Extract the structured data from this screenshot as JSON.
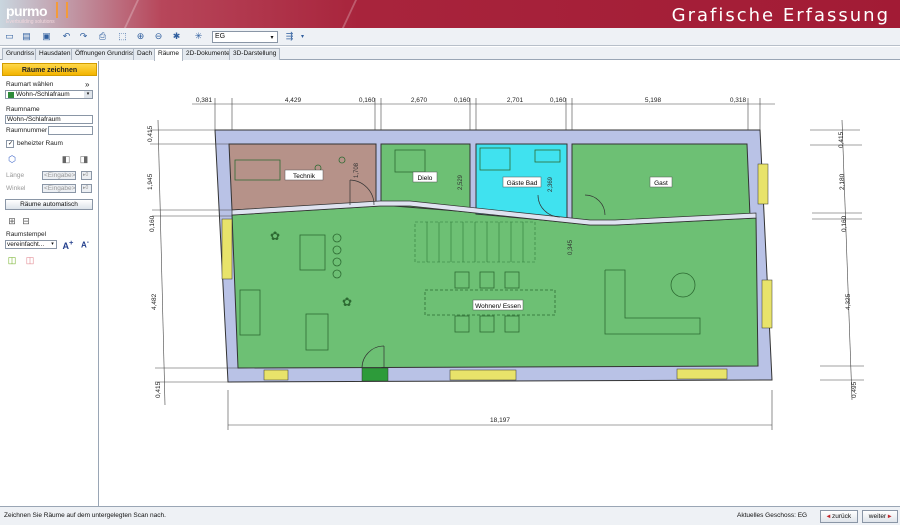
{
  "header": {
    "logo": "purmo",
    "logo_sub": "Everbuilding solutions",
    "title": "Grafische Erfassung"
  },
  "toolbar": {
    "floor_combo": "EG",
    "icons": [
      "new-icon",
      "open-icon",
      "save-icon",
      "undo-icon",
      "redo-icon",
      "print-icon",
      "zoom-window-icon",
      "zoom-in-icon",
      "zoom-out-icon",
      "snap-icon",
      "grid-icon",
      "floor-select",
      "layers-icon"
    ]
  },
  "tabs": [
    {
      "label": "Grundriss"
    },
    {
      "label": "Hausdaten"
    },
    {
      "label": "Öffnungen Grundriss"
    },
    {
      "label": "Dach"
    },
    {
      "label": "Räume",
      "active": true
    },
    {
      "label": "2D-Dokumente"
    },
    {
      "label": "3D-Darstellung"
    }
  ],
  "sidebar": {
    "header": "Räume zeichnen",
    "room_type_label": "Raumart wählen",
    "room_type_value": "Wohn-/Schlafraum",
    "room_name_label": "Raumname",
    "room_name_value": "Wohn-/Schlafraum",
    "room_number_label": "Raumnummer",
    "room_number_value": "",
    "heated_label": "beheizter Raum",
    "length_label": "Länge",
    "angle_label": "Winkel",
    "input_placeholder": "<Eingabe>",
    "auto_button": "Räume automatisch",
    "stamp_label": "Raumstempel",
    "stamp_value": "vereinfacht..."
  },
  "plan": {
    "rooms": [
      "Technik",
      "Dielo",
      "Gäste Bad",
      "Gast",
      "Wohnen/ Essen"
    ],
    "dims_top": [
      "0,381",
      "4,429",
      "0,160",
      "2,670",
      "0,160",
      "2,701",
      "0,160",
      "5,198",
      "0,318"
    ],
    "dims_bottom": [
      "18,197"
    ],
    "dims_left": [
      "0,415",
      "1,945",
      "0,160",
      "4,482",
      "0,415"
    ],
    "dims_right": [
      "0,415",
      "2,180",
      "0,160",
      "4,325",
      "0,495"
    ],
    "inner_dims": [
      "1,708",
      "2,529",
      "2,369",
      "0,345"
    ]
  },
  "status": {
    "message": "Zeichnen Sie Räume auf dem untergelegten Scan nach.",
    "floor": "Aktuelles Geschoss: EG",
    "back": "zurück",
    "next": "weiter"
  },
  "colors": {
    "accent": "#a21b35",
    "room_green": "#5fbf5f",
    "room_brown": "#b58a78",
    "room_cyan": "#33e6f0",
    "wall": "#b9c2e6",
    "window": "#e8e36a"
  }
}
